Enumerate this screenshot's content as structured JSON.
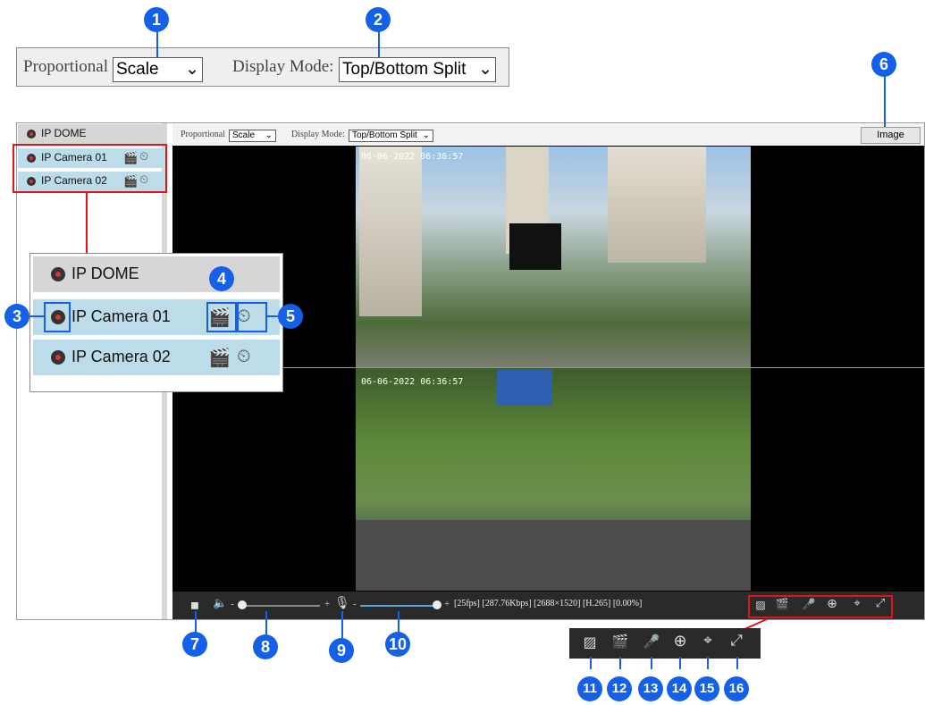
{
  "top_bar": {
    "proportional_label": "Proportional",
    "scale_value": "Scale",
    "display_mode_label": "Display Mode:",
    "display_mode_value": "Top/Bottom Split"
  },
  "tree": {
    "root": "IP DOME",
    "cameras": [
      "IP Camera 01",
      "IP Camera 02"
    ]
  },
  "toolbar": {
    "proportional_label": "Proportional",
    "scale_value": "Scale",
    "display_mode_label": "Display Mode:",
    "display_mode_value": "Top/Bottom Split",
    "image_button": "Image"
  },
  "video": {
    "top_timestamp": "06-06-2022 06:36:57",
    "bottom_timestamp": "06-06-2022 06:36:57"
  },
  "bottom_bar": {
    "minus": "-",
    "plus": "+",
    "status": "[25fps] [287.76Kbps] [2688×1520] [H.265] [0.00%]",
    "volume_level": 0.0,
    "mic_level": 1.0
  },
  "callouts": [
    "1",
    "2",
    "3",
    "4",
    "5",
    "6",
    "7",
    "8",
    "9",
    "10",
    "11",
    "12",
    "13",
    "14",
    "15",
    "16"
  ],
  "colors": {
    "callout_blue": "#1560e8",
    "highlight_red": "#e0151a",
    "selected_row": "#bcdcea"
  }
}
